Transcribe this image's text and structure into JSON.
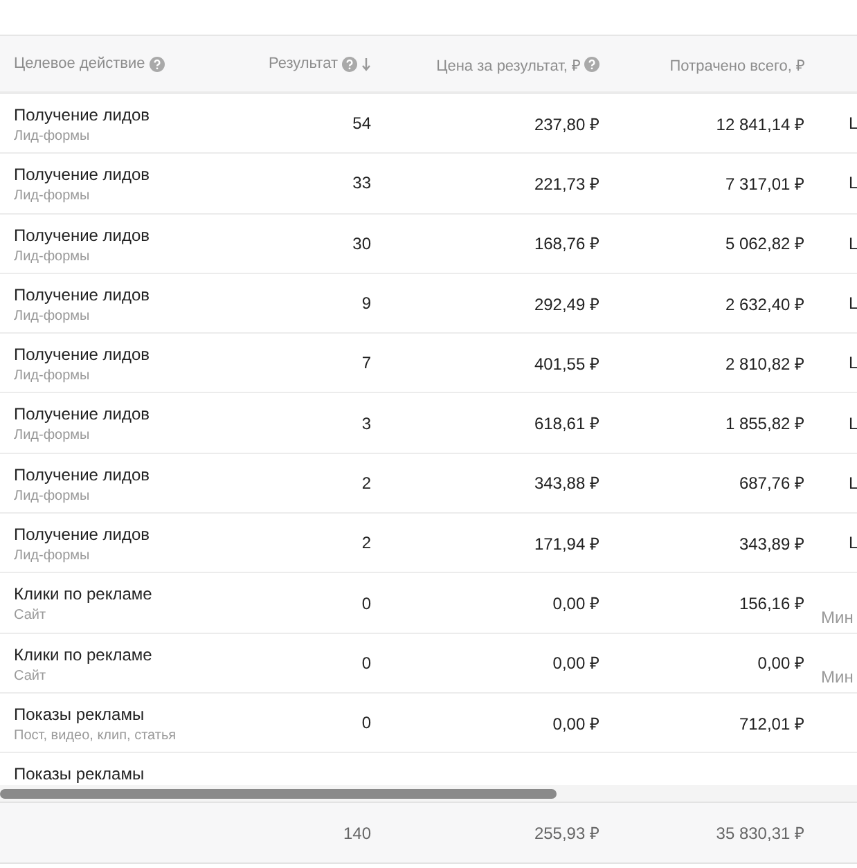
{
  "table": {
    "columns": [
      {
        "label": "Целевое действие",
        "help": true,
        "sorted": false
      },
      {
        "label": "Результат",
        "help": true,
        "sorted": true
      },
      {
        "label": "Цена за результат, ₽",
        "help": true,
        "sorted": false
      },
      {
        "label": "Потрачено всего, ₽",
        "help": false,
        "sorted": false
      }
    ],
    "rows": [
      {
        "action": "Получение лидов",
        "detail": "Лид-формы",
        "result": "54",
        "price": "237,80 ₽",
        "spent": "12 841,14 ₽",
        "column_5": "L"
      },
      {
        "action": "Получение лидов",
        "detail": "Лид-формы",
        "result": "33",
        "price": "221,73 ₽",
        "spent": "7 317,01 ₽",
        "column_5": "L"
      },
      {
        "action": "Получение лидов",
        "detail": "Лид-формы",
        "result": "30",
        "price": "168,76 ₽",
        "spent": "5 062,82 ₽",
        "column_5": "L"
      },
      {
        "action": "Получение лидов",
        "detail": "Лид-формы",
        "result": "9",
        "price": "292,49 ₽",
        "spent": "2 632,40 ₽",
        "column_5": "L"
      },
      {
        "action": "Получение лидов",
        "detail": "Лид-формы",
        "result": "7",
        "price": "401,55 ₽",
        "spent": "2 810,82 ₽",
        "column_5": "L"
      },
      {
        "action": "Получение лидов",
        "detail": "Лид-формы",
        "result": "3",
        "price": "618,61 ₽",
        "spent": "1 855,82 ₽",
        "column_5": "L"
      },
      {
        "action": "Получение лидов",
        "detail": "Лид-формы",
        "result": "2",
        "price": "343,88 ₽",
        "spent": "687,76 ₽",
        "column_5": "L"
      },
      {
        "action": "Получение лидов",
        "detail": "Лид-формы",
        "result": "2",
        "price": "171,94 ₽",
        "spent": "343,89 ₽",
        "column_5": "L"
      },
      {
        "action": "Клики по рекламе",
        "detail": "Сайт",
        "result": "0",
        "price": "0,00 ₽",
        "spent": "156,16 ₽",
        "column_5_low": "Мин"
      },
      {
        "action": "Клики по рекламе",
        "detail": "Сайт",
        "result": "0",
        "price": "0,00 ₽",
        "spent": "0,00 ₽",
        "column_5_low": "Мин"
      },
      {
        "action": "Показы рекламы",
        "detail": "Пост, видео, клип, статья",
        "result": "0",
        "price": "0,00 ₽",
        "spent": "712,01 ₽"
      },
      {
        "action": "Показы рекламы"
      }
    ],
    "totals": {
      "result": "140",
      "price": "255,93 ₽",
      "spent": "35 830,31 ₽"
    }
  }
}
